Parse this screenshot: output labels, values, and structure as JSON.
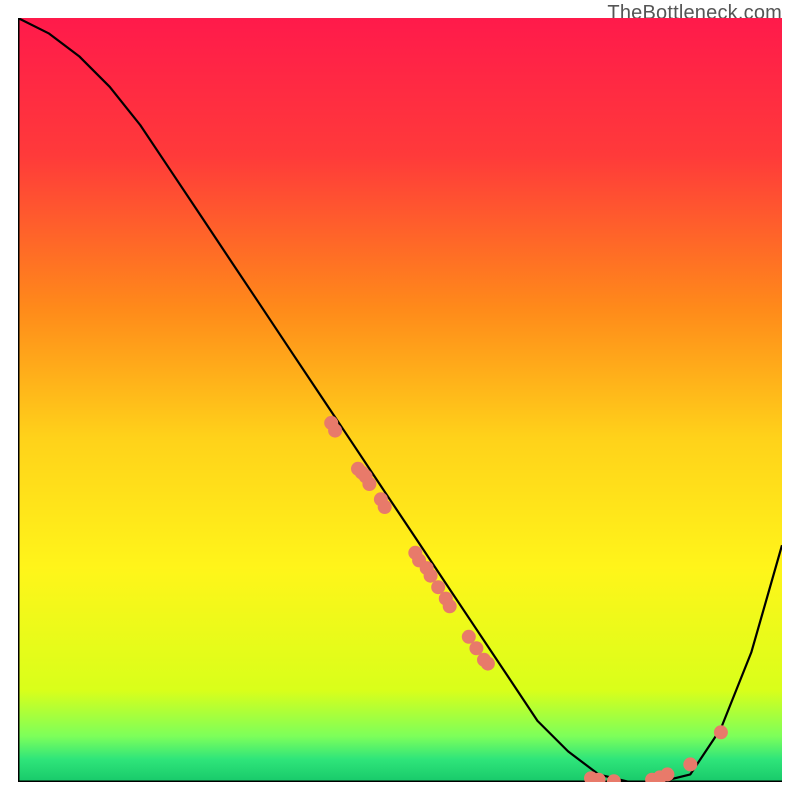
{
  "watermark": "TheBottleneck.com",
  "chart_data": {
    "type": "line",
    "title": "",
    "xlabel": "",
    "ylabel": "",
    "xlim": [
      0,
      100
    ],
    "ylim": [
      0,
      100
    ],
    "grid": false,
    "series": [
      {
        "name": "curve",
        "x": [
          0,
          4,
          8,
          12,
          16,
          20,
          24,
          28,
          32,
          36,
          40,
          44,
          48,
          52,
          56,
          60,
          64,
          68,
          72,
          76,
          80,
          84,
          88,
          92,
          96,
          100
        ],
        "y": [
          100,
          98,
          95,
          91,
          86,
          80,
          74,
          68,
          62,
          56,
          50,
          44,
          38,
          32,
          26,
          20,
          14,
          8,
          4,
          1,
          0,
          0,
          1,
          7,
          17,
          31
        ]
      }
    ],
    "points": [
      {
        "x": 41,
        "y": 47
      },
      {
        "x": 41.5,
        "y": 46
      },
      {
        "x": 44.5,
        "y": 41
      },
      {
        "x": 45,
        "y": 40.5
      },
      {
        "x": 45.5,
        "y": 40
      },
      {
        "x": 46,
        "y": 39
      },
      {
        "x": 47.5,
        "y": 37
      },
      {
        "x": 48,
        "y": 36
      },
      {
        "x": 52,
        "y": 30
      },
      {
        "x": 52.5,
        "y": 29
      },
      {
        "x": 53.5,
        "y": 28
      },
      {
        "x": 54,
        "y": 27
      },
      {
        "x": 55,
        "y": 25.5
      },
      {
        "x": 56,
        "y": 24
      },
      {
        "x": 56.5,
        "y": 23
      },
      {
        "x": 59,
        "y": 19
      },
      {
        "x": 60,
        "y": 17.5
      },
      {
        "x": 61,
        "y": 16
      },
      {
        "x": 61.5,
        "y": 15.5
      },
      {
        "x": 75,
        "y": 0.5
      },
      {
        "x": 76,
        "y": 0.3
      },
      {
        "x": 78,
        "y": 0.1
      },
      {
        "x": 83,
        "y": 0.3
      },
      {
        "x": 84,
        "y": 0.6
      },
      {
        "x": 85,
        "y": 1.0
      },
      {
        "x": 88,
        "y": 2.3
      },
      {
        "x": 92,
        "y": 6.5
      }
    ],
    "gradient_stops": [
      {
        "offset": 0.0,
        "color": "#ff1a4b"
      },
      {
        "offset": 0.18,
        "color": "#ff3a3a"
      },
      {
        "offset": 0.38,
        "color": "#ff8a1a"
      },
      {
        "offset": 0.55,
        "color": "#ffd21a"
      },
      {
        "offset": 0.72,
        "color": "#fff51a"
      },
      {
        "offset": 0.88,
        "color": "#d9ff1a"
      },
      {
        "offset": 0.94,
        "color": "#7dff5a"
      },
      {
        "offset": 0.97,
        "color": "#2fe57a"
      },
      {
        "offset": 1.0,
        "color": "#18c96a"
      }
    ],
    "point_color": "#e87a6a",
    "line_color": "#000000",
    "axis_color": "#000000"
  }
}
